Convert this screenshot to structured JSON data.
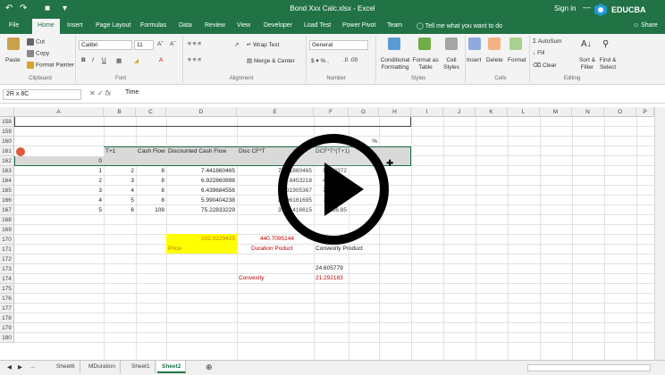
{
  "titlebar": {
    "title": "Bond Xxx Calc.xlsx - Excel",
    "signin": "Sign in",
    "brand": "EDUCBA"
  },
  "tabs": [
    "File",
    "Home",
    "Insert",
    "Page Layout",
    "Formulas",
    "Data",
    "Review",
    "View",
    "Developer",
    "Load Test",
    "Power Pivot",
    "Team"
  ],
  "tellme": "Tell me what you want to do",
  "share": "Share",
  "ribbon": {
    "clipboard": {
      "paste": "Paste",
      "cut": "Cut",
      "copy": "Copy",
      "format_painter": "Format Painter",
      "label": "Clipboard"
    },
    "font": {
      "name": "Calibri",
      "size": "11",
      "label": "Font"
    },
    "alignment": {
      "wrap": "Wrap Text",
      "merge": "Merge & Center",
      "label": "Alignment"
    },
    "number": {
      "format": "General",
      "label": "Number"
    },
    "styles": {
      "conditional": "Conditional Formatting",
      "table": "Format as Table",
      "cell": "Cell Styles",
      "label": "Styles"
    },
    "cells": {
      "insert": "Insert",
      "delete": "Delete",
      "format": "Format",
      "label": "Cells"
    },
    "editing": {
      "autosum": "AutoSum",
      "fill": "Fill",
      "clear": "Clear",
      "sort": "Sort & Filter",
      "find": "Find & Select",
      "label": "Editing"
    }
  },
  "formula_bar": {
    "namebox": "2R x 8C",
    "formula": "Time"
  },
  "columns": [
    "A",
    "B",
    "C",
    "D",
    "E",
    "F",
    "G",
    "H",
    "I",
    "J",
    "K",
    "L",
    "M",
    "N",
    "O",
    "P"
  ],
  "rows": [
    "158",
    "159",
    "160",
    "161",
    "162",
    "163",
    "164",
    "165",
    "166",
    "167",
    "168",
    "169",
    "170",
    "171",
    "172",
    "173",
    "174",
    "175",
    "176",
    "177",
    "178",
    "179",
    "180"
  ],
  "cells": {
    "r160_F": "YTM",
    "r160_G": "%",
    "r161_A": "e",
    "r161_B": "T+1",
    "r161_C": "Cash Flow",
    "r161_D": "Discounted Cash Flow",
    "r161_E": "Disc CF*T",
    "r161_F": "DCF*T*(T+1)",
    "r162_B": "0",
    "table": [
      [
        "1",
        "2",
        "8",
        "7.441860465",
        "7.441860465",
        "14.88372"
      ],
      [
        "2",
        "3",
        "8",
        "6.922860898",
        "13.8453218",
        "41.53597"
      ],
      [
        "3",
        "4",
        "8",
        "6.439684556",
        "19.31905367",
        "77.27615"
      ],
      [
        "4",
        "5",
        "8",
        "5.990404238",
        "23.96161695",
        "119.8080"
      ],
      [
        "5",
        "6",
        "108",
        "75.22833229",
        "376.1416615",
        "2256.85"
      ]
    ],
    "r169_D": "102.0229425",
    "r169_E": "440.7095144",
    "r170_D": "Price",
    "r170_E": "Duration Poduct",
    "r170_F": "Convexity Product",
    "r172_F": "24.605779",
    "r173_E": "Convexity",
    "r173_F": "21.292183"
  },
  "sheets": [
    "Sheet6",
    "MDuration",
    "Sheet1",
    "Sheet2"
  ],
  "colors": {
    "excel_green": "#217346",
    "highlight": "#ffff00",
    "header_fill": "#d9d9d9",
    "red_text": "#c00000"
  }
}
